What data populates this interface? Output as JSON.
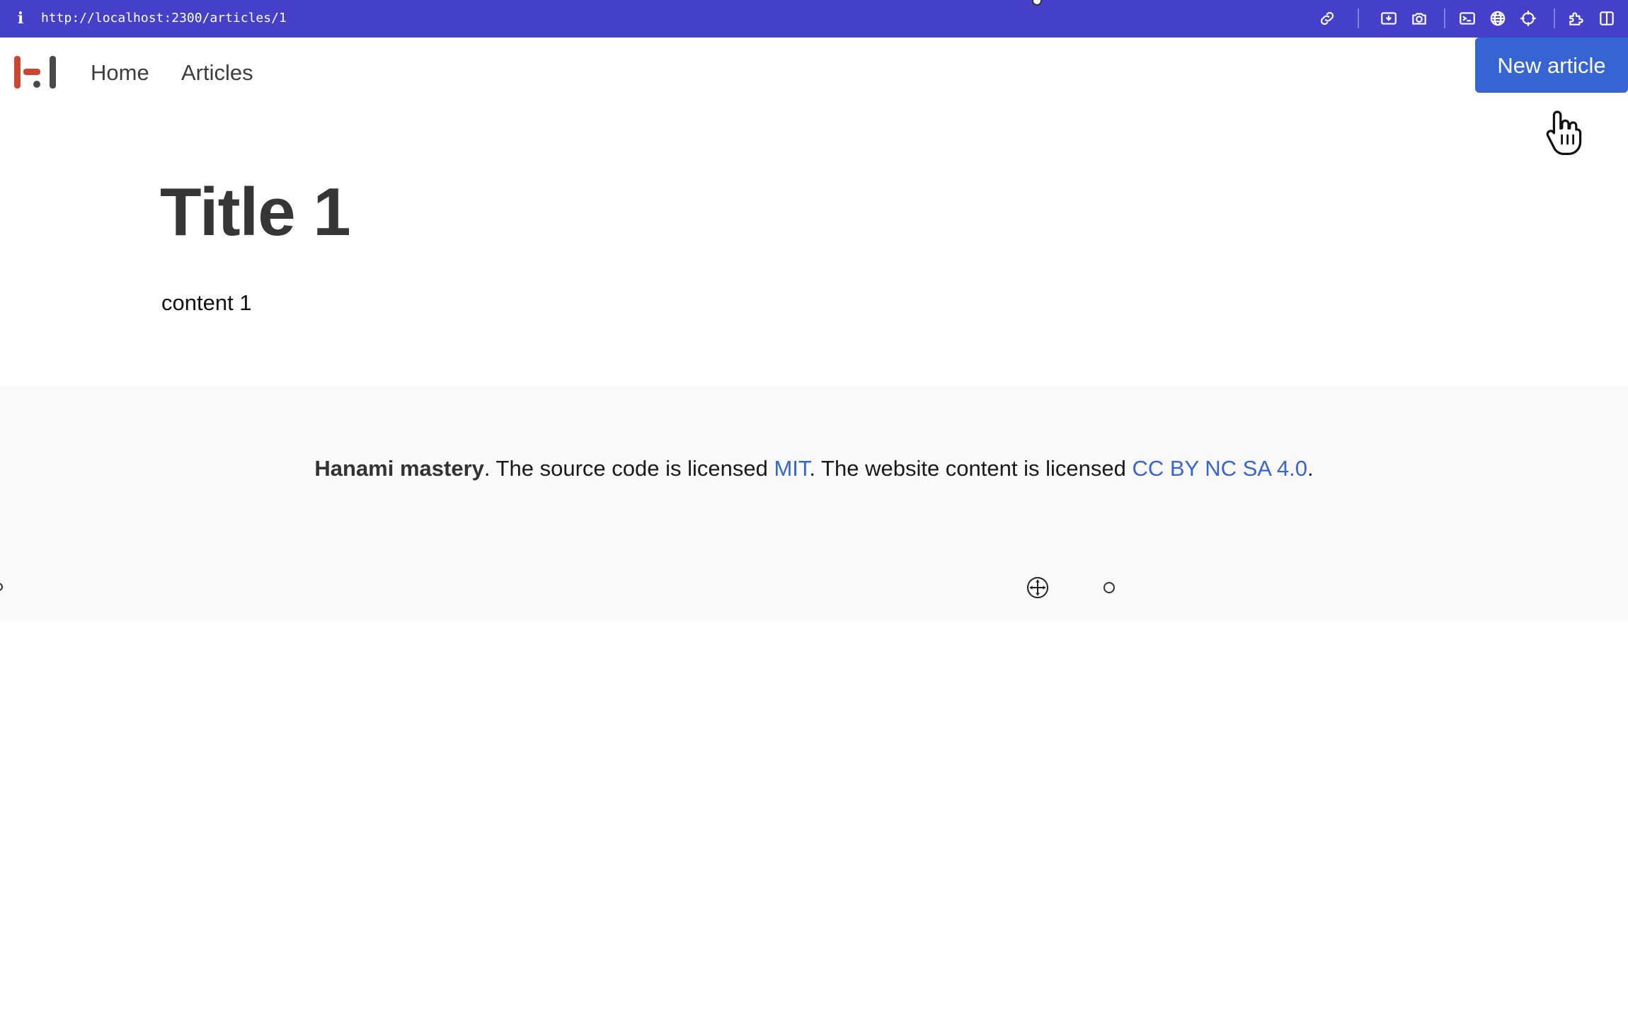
{
  "browser": {
    "url": "http://localhost:2300/articles/1",
    "toolbar_icons": [
      "link-icon",
      "screenshot-area-icon",
      "camera-icon",
      "terminal-icon",
      "globe-icon",
      "crosshair-icon",
      "extensions-icon",
      "sidebar-icon"
    ]
  },
  "header": {
    "logo": "hanami-logo",
    "nav": {
      "home": "Home",
      "articles": "Articles"
    },
    "new_article_label": "New article"
  },
  "article": {
    "title": "Title 1",
    "content": "content 1"
  },
  "footer": {
    "brand": "Hanami mastery",
    "text_1": ". The source code is licensed ",
    "mit_link": "MIT",
    "text_2": ". The website content is licensed ",
    "cc_link": "CC BY NC SA 4.0",
    "text_3": "."
  },
  "colors": {
    "browser_bar": "#4440c9",
    "accent": "#3665d3",
    "logo_red": "#c9472e",
    "logo_gray": "#4a4a4a",
    "footer_bg": "#f9f9f9"
  }
}
